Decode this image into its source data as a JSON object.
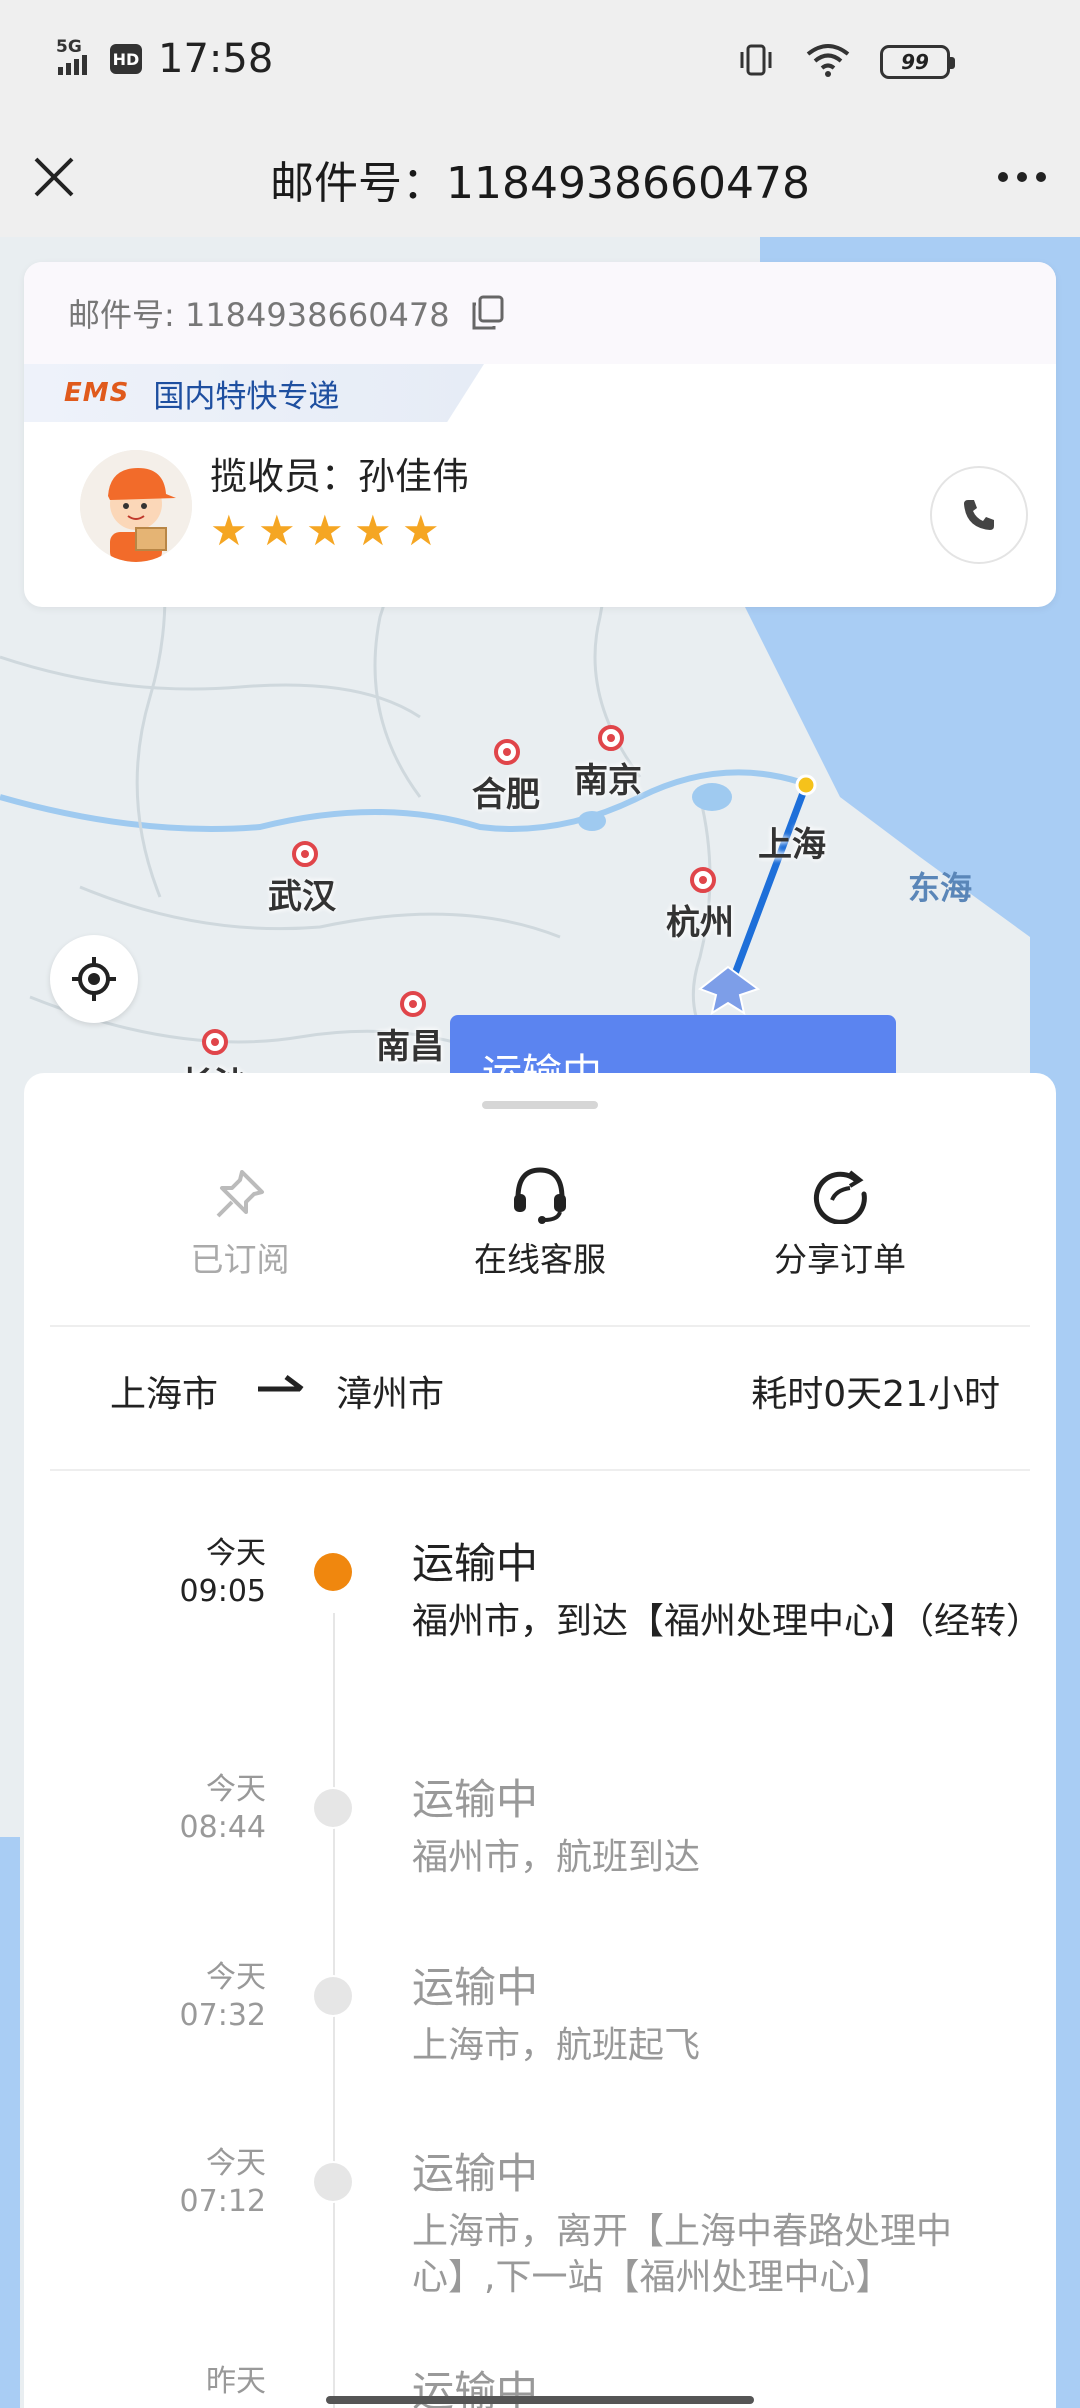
{
  "status_bar": {
    "network": "5G",
    "hd": "HD",
    "time": "17:58",
    "battery": "99"
  },
  "nav": {
    "title": "邮件号：1184938660478"
  },
  "info_card": {
    "mail_number_text": "邮件号: 1184938660478",
    "brand_logo": "EMS",
    "service_type": "国内特快专递",
    "courier_label": "揽收员：孙佳伟",
    "rating": 5
  },
  "map": {
    "cities": [
      "合肥",
      "南京",
      "上海",
      "杭州",
      "武汉",
      "南昌",
      "长沙"
    ],
    "sea": "东海",
    "status_chip": "运输中"
  },
  "actions": {
    "subscribed": "已订阅",
    "service": "在线客服",
    "share": "分享订单"
  },
  "route": {
    "from": "上海市",
    "to": "漳州市",
    "duration": "耗时0天21小时"
  },
  "timeline": [
    {
      "day": "今天",
      "time": "09:05",
      "status": "运输中",
      "desc": "福州市，到达【福州处理中心】（经转）",
      "active": true
    },
    {
      "day": "今天",
      "time": "08:44",
      "status": "运输中",
      "desc": "福州市，航班到达",
      "active": false
    },
    {
      "day": "今天",
      "time": "07:32",
      "status": "运输中",
      "desc": "上海市，航班起飞",
      "active": false
    },
    {
      "day": "今天",
      "time": "07:12",
      "status": "运输中",
      "desc": "上海市，离开【上海中春路处理中心】,下一站【福州处理中心】",
      "active": false
    },
    {
      "day": "昨天",
      "time": "",
      "status": "运输中",
      "desc": "",
      "active": false
    }
  ],
  "colors": {
    "accent_orange": "#f0870e",
    "chip_blue": "#5b84f0",
    "route_blue": "#1e6fd9",
    "star": "#f5a623"
  }
}
